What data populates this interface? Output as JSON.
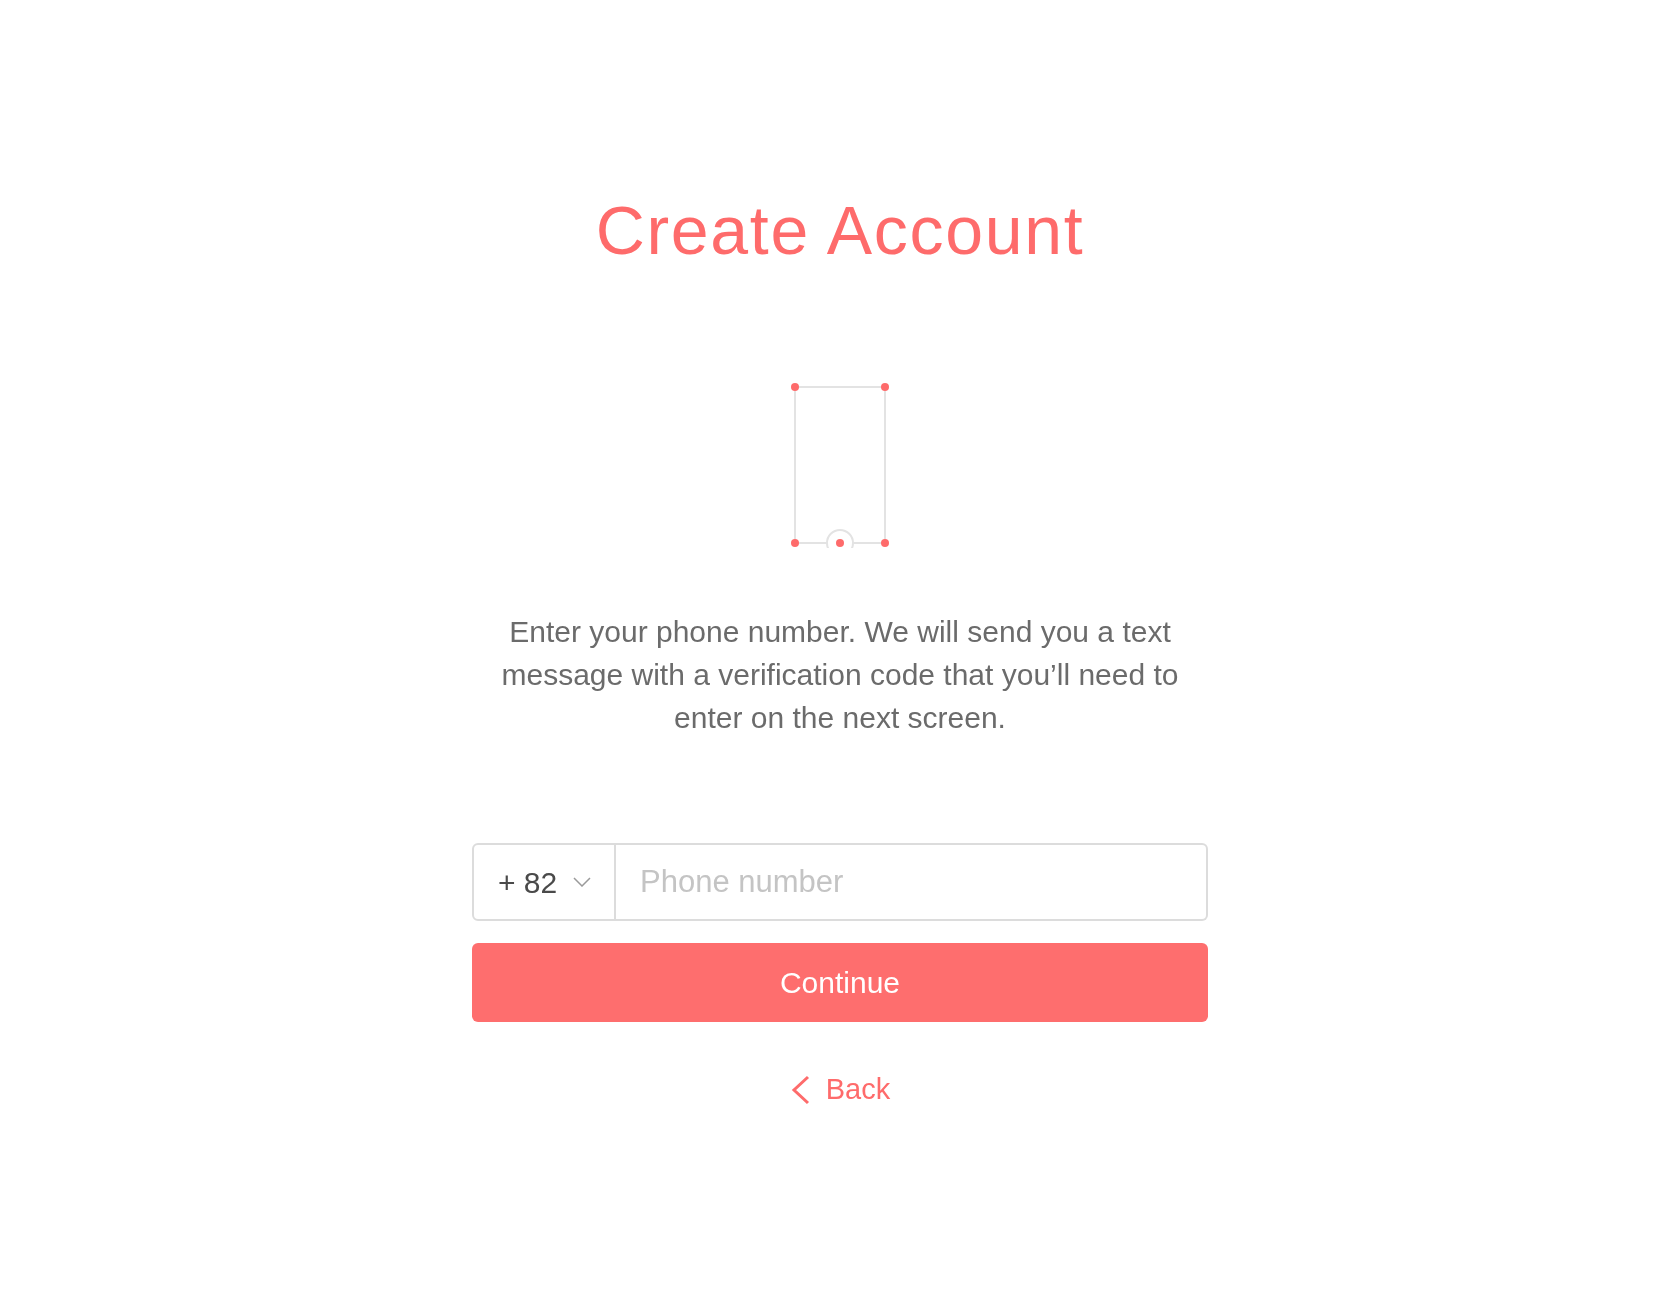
{
  "title": "Create Account",
  "description": "Enter your phone number. We will send you a text message with a verification code that you’ll need to enter on the next screen.",
  "phone_form": {
    "country_code": "+ 82",
    "placeholder": "Phone number"
  },
  "continue_button": "Continue",
  "back_link": "Back"
}
